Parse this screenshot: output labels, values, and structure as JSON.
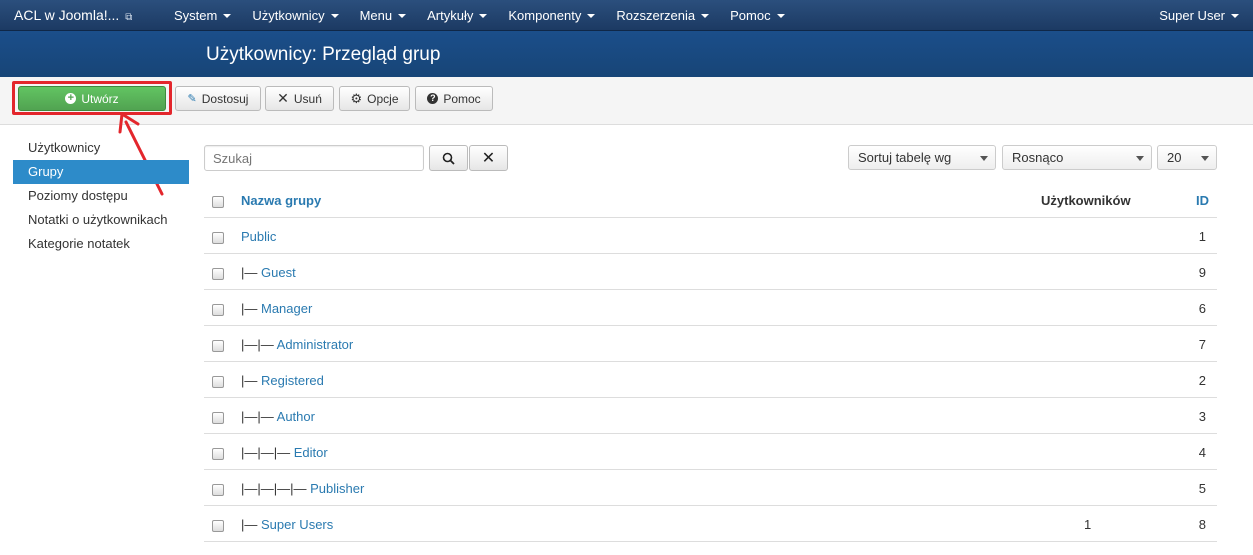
{
  "navbar": {
    "brand": "ACL w Joomla!...",
    "brand_icon": "external-link-icon",
    "menu": [
      {
        "label": "System"
      },
      {
        "label": "Użytkownicy"
      },
      {
        "label": "Menu"
      },
      {
        "label": "Artykuły"
      },
      {
        "label": "Komponenty"
      },
      {
        "label": "Rozszerzenia"
      },
      {
        "label": "Pomoc"
      }
    ],
    "user": "Super User"
  },
  "header": {
    "title": "Użytkownicy: Przegląd grup"
  },
  "toolbar": {
    "create": "Utwórz",
    "customize": "Dostosuj",
    "delete": "Usuń",
    "options": "Opcje",
    "help": "Pomoc"
  },
  "sidebar": {
    "items": [
      {
        "label": "Użytkownicy",
        "active": false
      },
      {
        "label": "Grupy",
        "active": true
      },
      {
        "label": "Poziomy dostępu",
        "active": false
      },
      {
        "label": "Notatki o użytkownikach",
        "active": false
      },
      {
        "label": "Kategorie notatek",
        "active": false
      }
    ]
  },
  "filters": {
    "search_placeholder": "Szukaj",
    "sort": "Sortuj tabelę wg",
    "direction": "Rosnąco",
    "limit": "20"
  },
  "table": {
    "headers": {
      "name": "Nazwa grupy",
      "users": "Użytkowników",
      "id": "ID"
    },
    "rows": [
      {
        "prefix": "",
        "name": "Public",
        "users": "",
        "id": "1"
      },
      {
        "prefix": "|— ",
        "name": "Guest",
        "users": "",
        "id": "9"
      },
      {
        "prefix": "|— ",
        "name": "Manager",
        "users": "",
        "id": "6"
      },
      {
        "prefix": "|—|— ",
        "name": "Administrator",
        "users": "",
        "id": "7"
      },
      {
        "prefix": "|— ",
        "name": "Registered",
        "users": "",
        "id": "2"
      },
      {
        "prefix": "|—|— ",
        "name": "Author",
        "users": "",
        "id": "3"
      },
      {
        "prefix": "|—|—|— ",
        "name": "Editor",
        "users": "",
        "id": "4"
      },
      {
        "prefix": "|—|—|—|— ",
        "name": "Publisher",
        "users": "",
        "id": "5"
      },
      {
        "prefix": "|— ",
        "name": "Super Users",
        "users": "1",
        "id": "8"
      }
    ]
  },
  "colors": {
    "navbar": "#1c3a63",
    "header": "#174577",
    "create_button": "#51a351",
    "sidebar_active": "#2d8bc9",
    "link": "#2a7ab0",
    "highlight": "#e3262c"
  }
}
